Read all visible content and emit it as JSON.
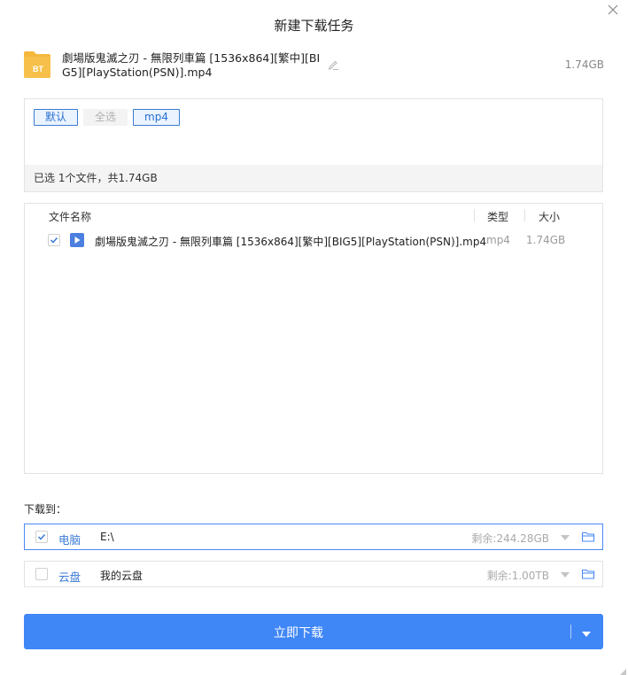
{
  "dialog": {
    "title": "新建下载任务"
  },
  "task": {
    "name": "劇場版鬼滅之刃 - 無限列車篇 [1536x864][繁中][BIG5][PlayStation(PSN)].mp4",
    "size": "1.74GB",
    "icon_label": "BT"
  },
  "filters": {
    "default_label": "默认",
    "select_all_label": "全选",
    "mp4_label": "mp4",
    "summary": "已选 1个文件，共1.74GB"
  },
  "file_list": {
    "columns": {
      "name": "文件名称",
      "type": "类型",
      "size": "大小"
    },
    "rows": [
      {
        "name": "劇場版鬼滅之刃 - 無限列車篇 [1536x864][繁中][BIG5][PlayStation(PSN)].mp4",
        "type": "mp4",
        "size": "1.74GB",
        "checked": true
      }
    ]
  },
  "destination": {
    "label": "下载到：",
    "options": [
      {
        "name": "电脑",
        "path": "E:\\",
        "free": "剩余:244.28GB",
        "checked": true
      },
      {
        "name": "云盘",
        "path": "我的云盘",
        "free": "剩余:1.00TB",
        "checked": false
      }
    ]
  },
  "actions": {
    "download_now": "立即下载"
  },
  "colors": {
    "accent": "#3f86f7",
    "link": "#3a7bd5",
    "bt_icon": "#f5b83d"
  }
}
